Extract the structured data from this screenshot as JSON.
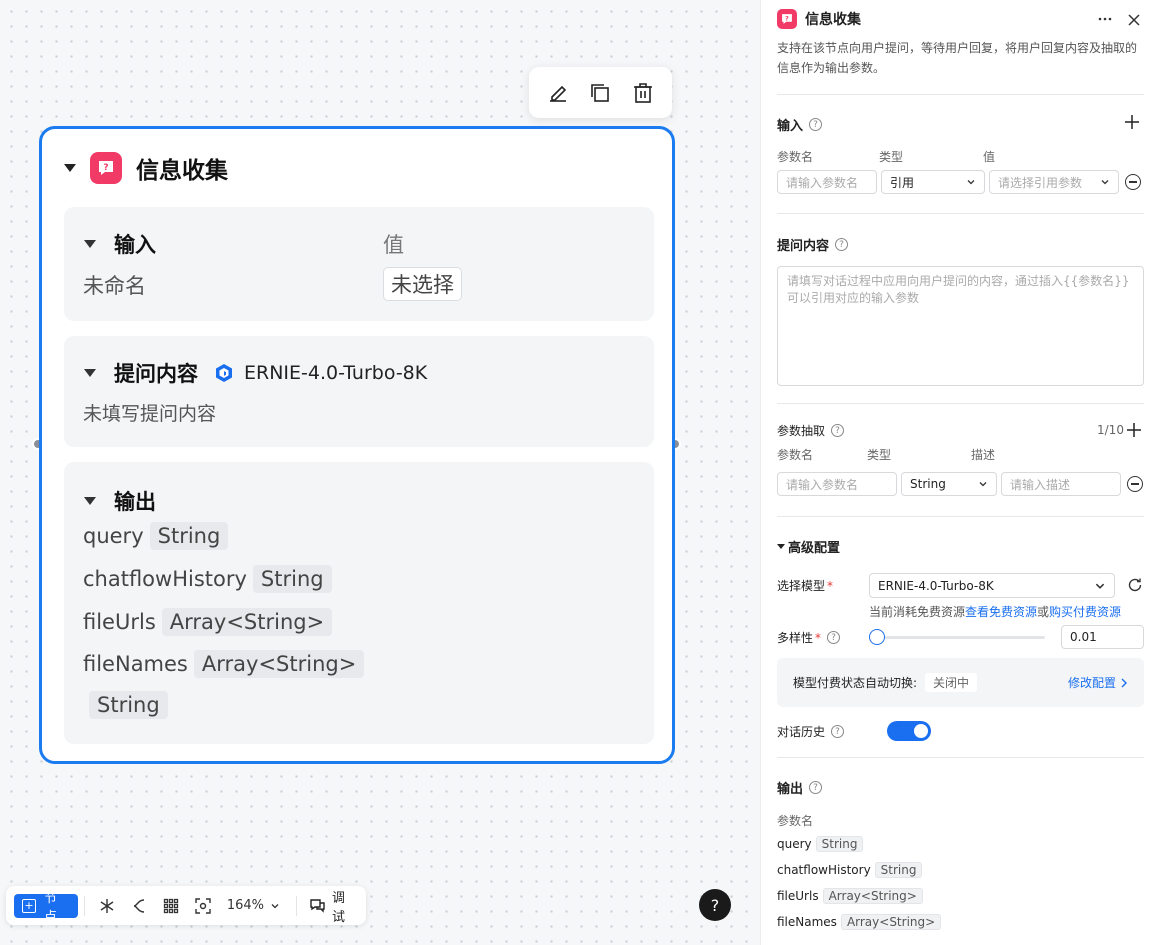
{
  "node": {
    "title": "信息收集",
    "input_section": {
      "label": "输入",
      "value_header": "值",
      "param_name": "未命名",
      "param_value": "未选择"
    },
    "prompt_section": {
      "label": "提问内容",
      "model": "ERNIE-4.0-Turbo-8K",
      "placeholder": "未填写提问内容"
    },
    "output_section": {
      "label": "输出",
      "items": [
        {
          "name": "query",
          "type": "String"
        },
        {
          "name": "chatflowHistory",
          "type": "String"
        },
        {
          "name": "fileUrls",
          "type": "Array<String>"
        },
        {
          "name": "fileNames",
          "type": "Array<String>"
        },
        {
          "name": "",
          "type": "String"
        }
      ]
    }
  },
  "bottom_bar": {
    "add_node": "节点",
    "zoom": "164%",
    "debug": "调试"
  },
  "help": "?",
  "panel": {
    "title": "信息收集",
    "description": "支持在该节点向用户提问，等待用户回复，将用户回复内容及抽取的信息作为输出参数。",
    "input": {
      "label": "输入",
      "col_name": "参数名",
      "col_type": "类型",
      "col_value": "值",
      "name_placeholder": "请输入参数名",
      "type_value": "引用",
      "value_placeholder": "请选择引用参数"
    },
    "prompt": {
      "label": "提问内容",
      "placeholder": "请填写对话过程中应用向用户提问的内容，通过插入{{参数名}}可以引用对应的输入参数"
    },
    "extract": {
      "label": "参数抽取",
      "count": "1/10",
      "col_name": "参数名",
      "col_type": "类型",
      "col_desc": "描述",
      "name_placeholder": "请输入参数名",
      "type_value": "String",
      "desc_placeholder": "请输入描述"
    },
    "advanced": {
      "label": "高级配置",
      "model_label": "选择模型",
      "model_value": "ERNIE-4.0-Turbo-8K",
      "resource_text": "当前消耗免费资源",
      "free_link": "查看免费资源",
      "or_text": "或",
      "paid_link": "购买付费资源",
      "diversity_label": "多样性",
      "diversity_value": "0.01",
      "diversity_fraction": 0.01,
      "auto_switch_label": "模型付费状态自动切换:",
      "auto_switch_status": "关闭中",
      "modify_config": "修改配置",
      "history_label": "对话历史",
      "history_enabled": true
    },
    "output": {
      "label": "输出",
      "col_name": "参数名",
      "items": [
        {
          "name": "query",
          "type": "String"
        },
        {
          "name": "chatflowHistory",
          "type": "String"
        },
        {
          "name": "fileUrls",
          "type": "Array<String>"
        },
        {
          "name": "fileNames",
          "type": "Array<String>"
        }
      ]
    }
  },
  "colors": {
    "accent": "#1a6ff0",
    "node_border": "#1a7cf0",
    "app_icon": "#f23a66"
  }
}
